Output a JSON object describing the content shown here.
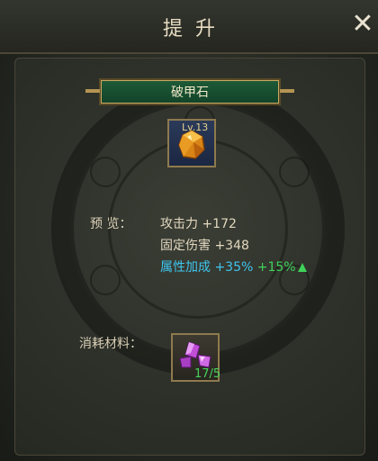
{
  "window": {
    "title": "提升"
  },
  "item": {
    "name": "破甲石",
    "level": "Lv.13"
  },
  "preview": {
    "label": "预  览：",
    "stats": [
      {
        "name": "攻击力",
        "value": "+172"
      },
      {
        "name": "固定伤害",
        "value": "+348"
      }
    ],
    "bonus": {
      "name": "属性加成",
      "value": "+35%",
      "increase": "+15%"
    }
  },
  "materials": {
    "label": "消耗材料：",
    "count": "17/5"
  },
  "colors": {
    "bonus_text": "#3fc5ee",
    "increase_text": "#3fd35a",
    "count_text": "#47d25a",
    "name_banner": "#1d5a36"
  },
  "icons": {
    "close": "close-icon",
    "gem": "amber-gem-icon",
    "material": "purple-crystal-icon",
    "arrow": "up-arrow-icon"
  }
}
